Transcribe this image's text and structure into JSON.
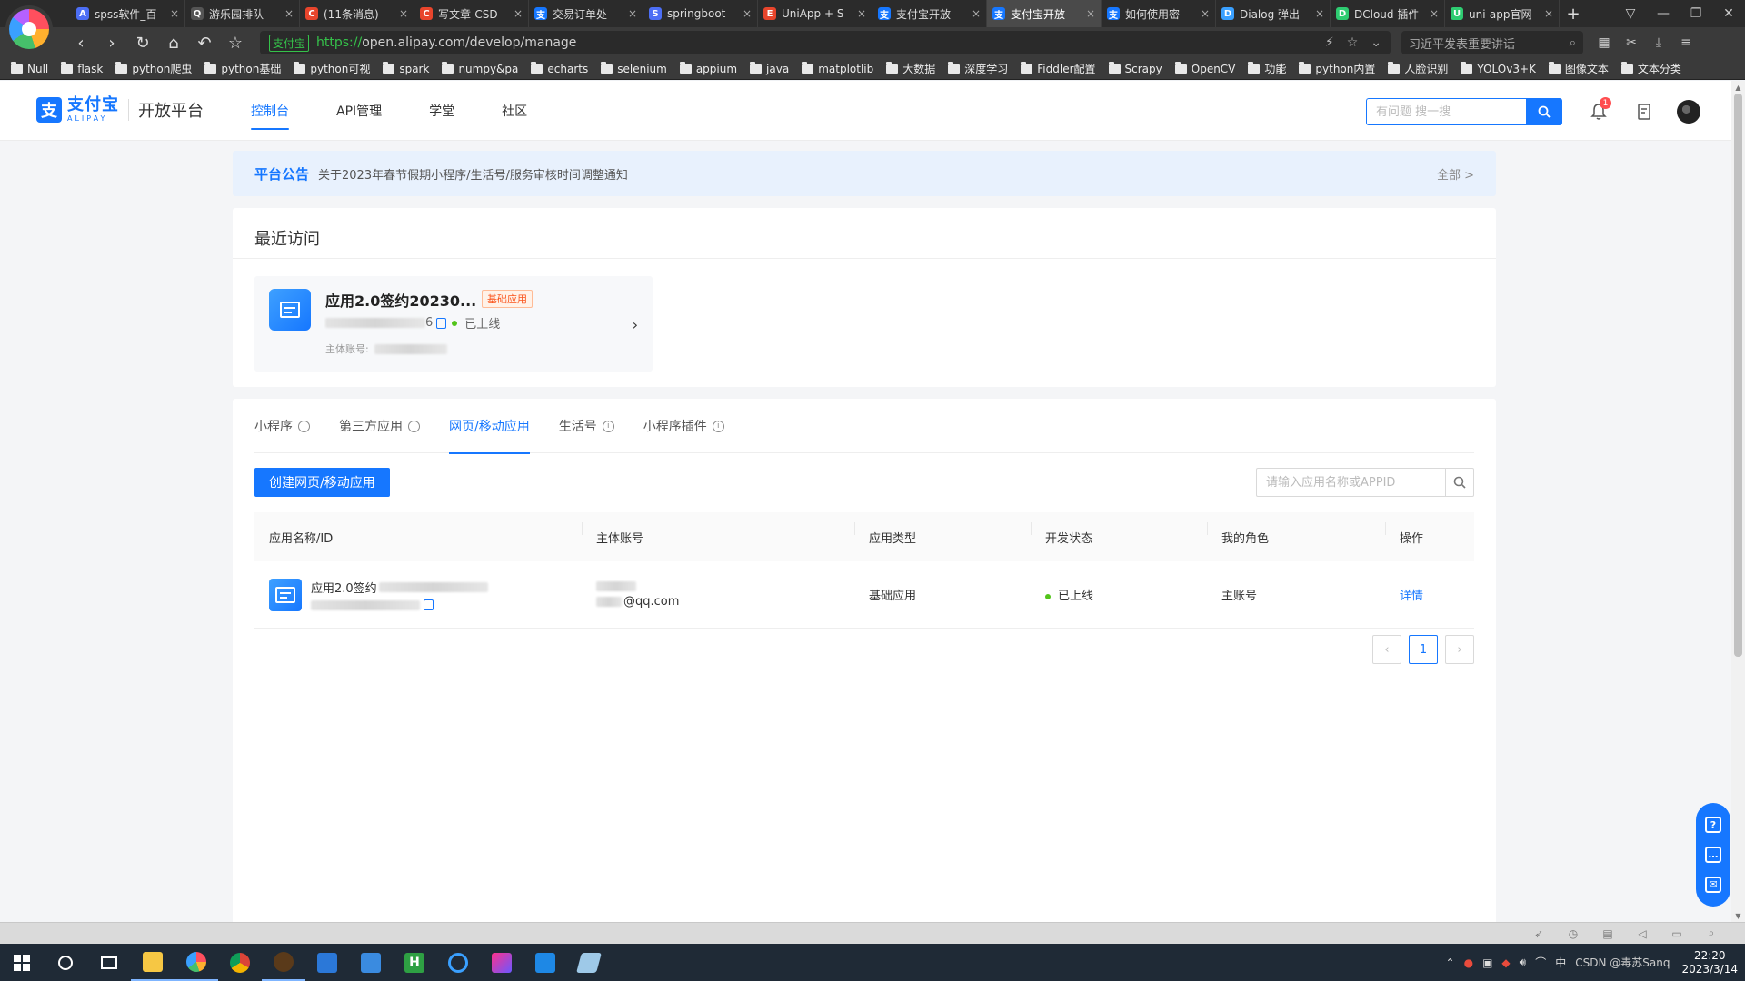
{
  "browser": {
    "tabs": [
      {
        "label": "spss软件_百",
        "color": "#4c6ef5",
        "icon": "A"
      },
      {
        "label": "游乐园排队",
        "color": "#555555",
        "icon": "Q"
      },
      {
        "label": "(11条消息)",
        "color": "#e8452c",
        "icon": "C"
      },
      {
        "label": "写文章-CSD",
        "color": "#e8452c",
        "icon": "C"
      },
      {
        "label": "交易订单处",
        "color": "#1677ff",
        "icon": "支"
      },
      {
        "label": "springboot",
        "color": "#4c6ef5",
        "icon": "S"
      },
      {
        "label": "UniApp + S",
        "color": "#e8452c",
        "icon": "E"
      },
      {
        "label": "支付宝开放",
        "color": "#1677ff",
        "icon": "支"
      },
      {
        "label": "支付宝开放",
        "color": "#1677ff",
        "icon": "支",
        "active": true
      },
      {
        "label": "如何使用密",
        "color": "#1677ff",
        "icon": "支"
      },
      {
        "label": "Dialog 弹出",
        "color": "#3aa0ff",
        "icon": "D"
      },
      {
        "label": "DCloud 插件",
        "color": "#2ecc71",
        "icon": "D"
      },
      {
        "label": "uni-app官网",
        "color": "#2ecc71",
        "icon": "U"
      }
    ],
    "url_secure_label": "支付宝",
    "url_scheme": "https://",
    "url_rest": "open.alipay.com/develop/manage",
    "search_hint": "习近平发表重要讲话",
    "bookmarks": [
      "Null",
      "flask",
      "python爬虫",
      "python基础",
      "python可视",
      "spark",
      "numpy&pa",
      "echarts",
      "selenium",
      "appium",
      "java",
      "matplotlib",
      "大数据",
      "深度学习",
      "Fiddler配置",
      "Scrapy",
      "OpenCV",
      "功能",
      "python内置",
      "人脸识别",
      "YOLOv3+K",
      "图像文本",
      "文本分类"
    ]
  },
  "header": {
    "brand_cn": "支付宝",
    "brand_en": "ALIPAY",
    "platform": "开放平台",
    "nav": [
      "控制台",
      "API管理",
      "学堂",
      "社区"
    ],
    "search_placeholder": "有问题 搜一搜",
    "notification_count": "1"
  },
  "notice": {
    "title": "平台公告",
    "message": "关于2023年春节假期小程序/生活号/服务审核时间调整通知",
    "all_label": "全部 >"
  },
  "recent": {
    "title": "最近访问",
    "app_name": "应用2.0签约20230...",
    "app_tag": "基础应用",
    "app_id_suffix": "6",
    "status": "已上线",
    "owner_label": "主体账号:"
  },
  "apps": {
    "tabs": [
      "小程序",
      "第三方应用",
      "网页/移动应用",
      "生活号",
      "小程序插件"
    ],
    "active_tab_index": 2,
    "create_button": "创建网页/移动应用",
    "search_placeholder": "请输入应用名称或APPID",
    "columns": [
      "应用名称/ID",
      "主体账号",
      "应用类型",
      "开发状态",
      "我的角色",
      "操作"
    ],
    "rows": [
      {
        "app_name": "应用2.0签约",
        "owner_email_suffix": "@qq.com",
        "type": "基础应用",
        "status": "已上线",
        "role": "主账号",
        "action": "详情"
      }
    ],
    "page": "1"
  },
  "statusbar": {
    "icons": [
      "rocket-icon",
      "clock-icon",
      "trash-icon",
      "speaker-icon",
      "window-icon",
      "zoom-icon"
    ]
  },
  "taskbar": {
    "clock_time": "22:20",
    "clock_date": "2023/3/14",
    "ime": "中",
    "watermark": "CSDN @毒苏Sanq"
  },
  "colors": {
    "accent": "#1677ff",
    "online": "#52c41a",
    "tag": "#fa541c"
  }
}
